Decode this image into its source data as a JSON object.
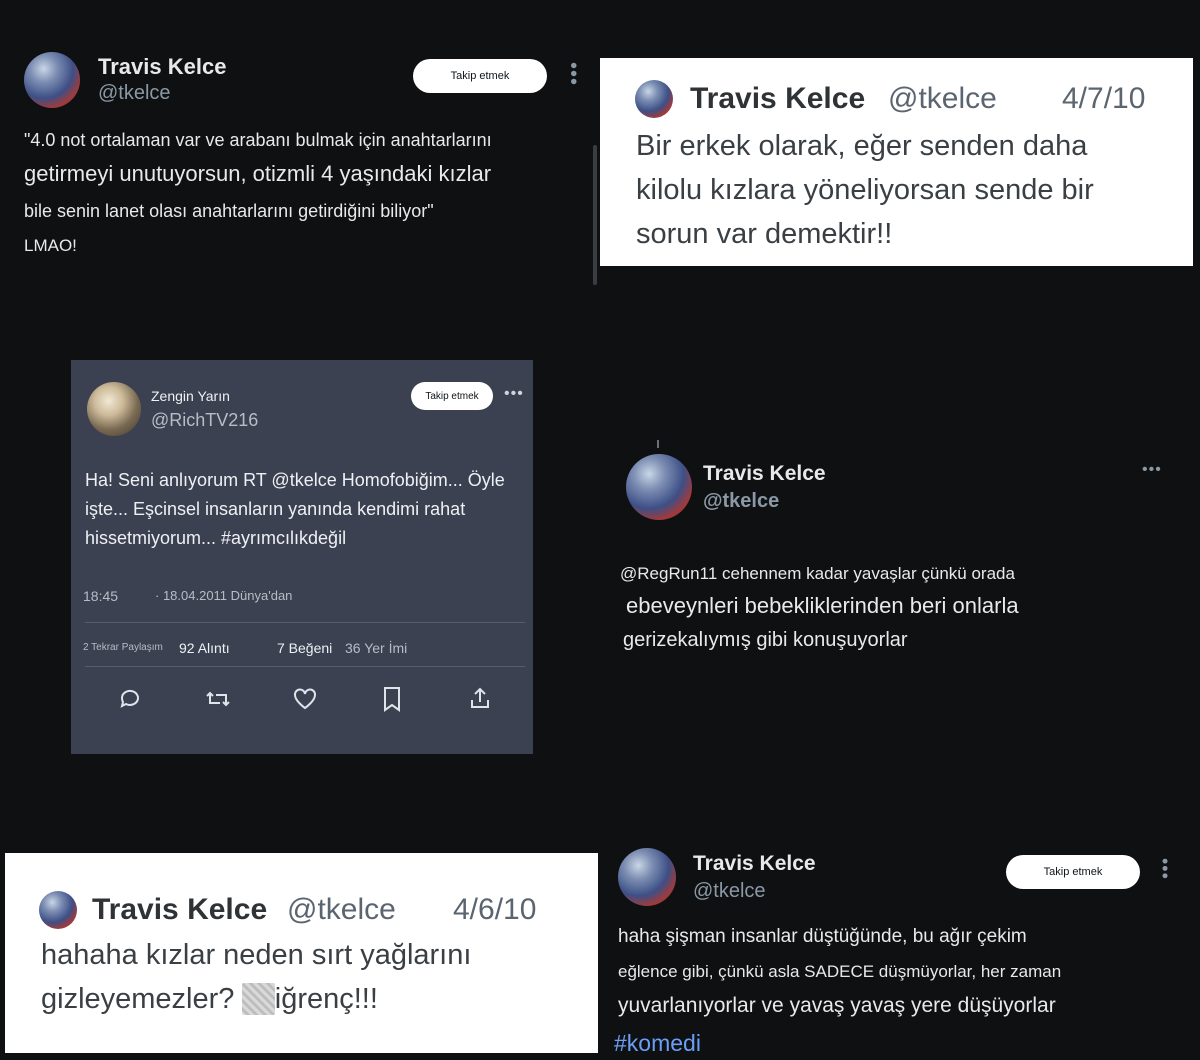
{
  "tweet1": {
    "name": "Travis Kelce",
    "handle": "@tkelce",
    "follow": "Takip etmek",
    "lines": [
      "\"4.0 not ortalaman var ve arabanı bulmak için anahtarlarını",
      "getirmeyi unutuyorsun, otizmli 4 yaşındaki kızlar",
      "bile senin lanet olası anahtarlarını getirdiğini biliyor\"",
      "LMAO!"
    ]
  },
  "tweet2": {
    "name": "Travis Kelce",
    "handle": "@tkelce",
    "date": "4/7/10",
    "lines": [
      "Bir erkek olarak, eğer senden daha",
      "kilolu kızlara yöneliyorsan sende bir",
      "sorun var demektir!!"
    ]
  },
  "tweet3": {
    "name": "Zengin Yarın",
    "handle": "@RichTV216",
    "follow": "Takip etmek",
    "lines": [
      "Ha! Seni anlıyorum RT @tkelce Homofobiğim... Öyle",
      "işte... Eşcinsel insanların yanında kendimi rahat",
      "hissetmiyorum... #ayrımcılıkdeğil"
    ],
    "time": "18:45",
    "date_source": "· 18.04.2011 Dünya'dan",
    "retweets_label": "2 Tekrar Paylaşım",
    "quotes": "92 Alıntı",
    "likes": "7 Beğeni",
    "views": "36 Yer İmi"
  },
  "tweet4": {
    "name": "Travis Kelce",
    "handle": "@tkelce",
    "lines": [
      "@RegRun11 cehennem kadar yavaşlar çünkü orada",
      "ebeveynleri bebekliklerinden beri onlarla",
      "gerizekalıymış gibi konuşuyorlar"
    ]
  },
  "tweet5": {
    "name": "Travis Kelce",
    "handle": "@tkelce",
    "date": "4/6/10",
    "line1": "hahaha kızlar neden sırt yağlarını",
    "line2_pre": "gizleyemezler?",
    "line2_blur": "bu",
    "line2_post": "iğrenç!!!"
  },
  "tweet6": {
    "name": "Travis Kelce",
    "handle": "@tkelce",
    "follow": "Takip etmek",
    "lines": [
      "haha şişman insanlar düştüğünde, bu ağır çekim",
      "eğlence gibi, çünkü asla SADECE düşmüyorlar, her zaman",
      "yuvarlanıyorlar ve yavaş yavaş yere düşüyorlar"
    ],
    "hashtag": "#komedi"
  },
  "icons": [
    "reply-icon",
    "retweet-icon",
    "like-icon",
    "bookmark-icon",
    "share-icon",
    "more-icon"
  ]
}
